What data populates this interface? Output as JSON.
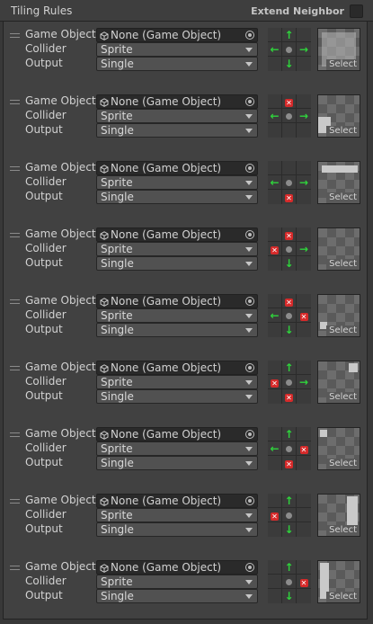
{
  "header": {
    "title": "Tiling Rules",
    "extend_neighbor_label": "Extend Neighbor",
    "extend_neighbor_checked": false
  },
  "labels": {
    "game_object": "Game Object",
    "collider": "Collider",
    "output": "Output",
    "select": "Select"
  },
  "rules": [
    {
      "game_object": "None (Game Object)",
      "collider": "Sprite",
      "output": "Single",
      "neighbors": [
        "",
        "up",
        "",
        "left",
        "center",
        "right",
        "",
        "down",
        ""
      ]
    },
    {
      "game_object": "None (Game Object)",
      "collider": "Sprite",
      "output": "Single",
      "neighbors": [
        "",
        "x",
        "",
        "left",
        "center",
        "right",
        "",
        "",
        ""
      ]
    },
    {
      "game_object": "None (Game Object)",
      "collider": "Sprite",
      "output": "Single",
      "neighbors": [
        "",
        "",
        "",
        "left",
        "center",
        "right",
        "",
        "x",
        ""
      ]
    },
    {
      "game_object": "None (Game Object)",
      "collider": "Sprite",
      "output": "Single",
      "neighbors": [
        "",
        "x",
        "",
        "x",
        "center",
        "right",
        "",
        "down",
        ""
      ]
    },
    {
      "game_object": "None (Game Object)",
      "collider": "Sprite",
      "output": "Single",
      "neighbors": [
        "",
        "x",
        "",
        "left",
        "center",
        "x",
        "",
        "down",
        ""
      ]
    },
    {
      "game_object": "None (Game Object)",
      "collider": "Sprite",
      "output": "Single",
      "neighbors": [
        "",
        "up",
        "",
        "x",
        "center",
        "right",
        "",
        "x",
        ""
      ]
    },
    {
      "game_object": "None (Game Object)",
      "collider": "Sprite",
      "output": "Single",
      "neighbors": [
        "",
        "up",
        "",
        "left",
        "center",
        "x",
        "",
        "x",
        ""
      ]
    },
    {
      "game_object": "None (Game Object)",
      "collider": "Sprite",
      "output": "Single",
      "neighbors": [
        "",
        "up",
        "",
        "x",
        "center",
        "",
        "",
        "down",
        ""
      ]
    },
    {
      "game_object": "None (Game Object)",
      "collider": "Sprite",
      "output": "Single",
      "neighbors": [
        "",
        "up",
        "",
        "",
        "center",
        "x",
        "",
        "down",
        ""
      ]
    }
  ],
  "icons": {
    "up": "arrow-up-icon",
    "down": "arrow-down-icon",
    "left": "arrow-left-icon",
    "right": "arrow-right-icon",
    "x": "x-mark-icon",
    "center": "center-dot-icon"
  },
  "colors": {
    "arrow": "#2fd33c",
    "x_mark": "#d62a2a"
  }
}
